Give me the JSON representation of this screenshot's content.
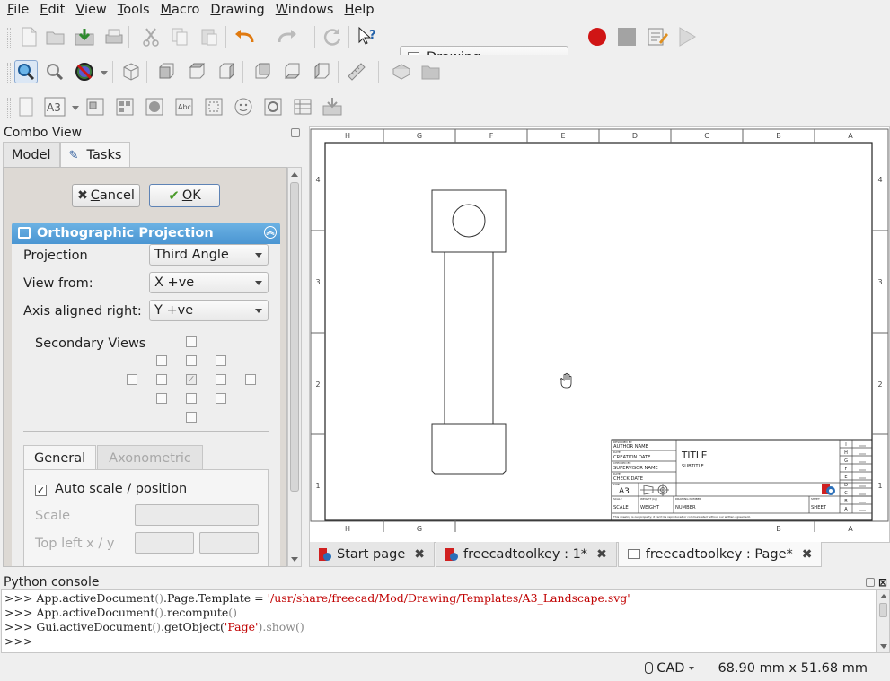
{
  "menu": [
    "File",
    "Edit",
    "View",
    "Tools",
    "Macro",
    "Drawing",
    "Windows",
    "Help"
  ],
  "menu_mnemonics": [
    "F",
    "E",
    "V",
    "T",
    "M",
    "D",
    "W",
    "H"
  ],
  "workbench": {
    "selected": "Drawing"
  },
  "combo_view": {
    "title": "Combo View",
    "tabs": [
      "Model",
      "Tasks"
    ],
    "active_tab": "Tasks",
    "cancel_label": "Cancel",
    "ok_label": "OK"
  },
  "ortho": {
    "title": "Orthographic Projection",
    "projection_label": "Projection",
    "projection_value": "Third Angle",
    "view_from_label": "View from:",
    "view_from_value": "X +ve",
    "axis_right_label": "Axis aligned right:",
    "axis_right_value": "Y +ve",
    "secondary_views_label": "Secondary Views",
    "subtabs": [
      "General",
      "Axonometric"
    ],
    "active_subtab": "General",
    "auto_scale_label": "Auto scale / position",
    "auto_scale_checked": true,
    "scale_label": "Scale",
    "top_left_label": "Top left x / y"
  },
  "drawing": {
    "col_letters_top": [
      "H",
      "G",
      "F",
      "E",
      "D",
      "C",
      "B",
      "A"
    ],
    "col_letters_bottom": [
      "H",
      "G",
      "B",
      "A"
    ],
    "row_numbers": [
      "4",
      "3",
      "2",
      "1"
    ],
    "title_block": {
      "designed_by_tag": "DESIGNED BY:",
      "author": "AUTHOR NAME",
      "date_tag": "DATE:",
      "creation_date": "CREATION DATE",
      "checked_by_tag": "CHECKED BY:",
      "supervisor": "SUPERVISOR NAME",
      "check_date": "CHECK DATE",
      "size_tag": "SIZE",
      "size": "A3",
      "title": "TITLE",
      "subtitle": "SUBTITLE",
      "scale_tag": "SCALE",
      "scale": "SCALE",
      "weight_tag": "WEIGHT (kg)",
      "weight": "WEIGHT",
      "drawing_number_tag": "DRAWING NUMBER",
      "number": "NUMBER",
      "sheet_tag": "SHEET",
      "sheet": "SHEET",
      "disclaimer": "This drawing is our property; it can't be reproduced or communicated without our written agreement.",
      "revisions": [
        "I",
        "H",
        "G",
        "F",
        "E",
        "D",
        "C",
        "B",
        "A"
      ]
    }
  },
  "doc_tabs": [
    {
      "label": "Start page",
      "active": false
    },
    {
      "label": "freecadtoolkey : 1*",
      "active": false
    },
    {
      "label": "freecadtoolkey : Page*",
      "active": true
    }
  ],
  "python_console": {
    "title": "Python console",
    "prompt": ">>>",
    "lines": [
      {
        "a": "App",
        "b": ".activeDocument",
        "c": "()",
        "d": ".Page.Template = ",
        "s": "'/usr/share/freecad/Mod/Drawing/Templates/A3_Landscape.svg'"
      },
      {
        "a": "App",
        "b": ".activeDocument",
        "c": "()",
        "d": ".recompute",
        "e": "()"
      },
      {
        "a": "Gui",
        "b": ".activeDocument",
        "c": "()",
        "d": ".getObject(",
        "s": "'Page'",
        "e": ").show()"
      }
    ]
  },
  "status": {
    "nav_style": "CAD",
    "dimensions": "68.90 mm x 51.68 mm"
  },
  "colors": {
    "accent_blue": "#4a95d2",
    "record_red": "#d01515",
    "string_red": "#c00000"
  }
}
